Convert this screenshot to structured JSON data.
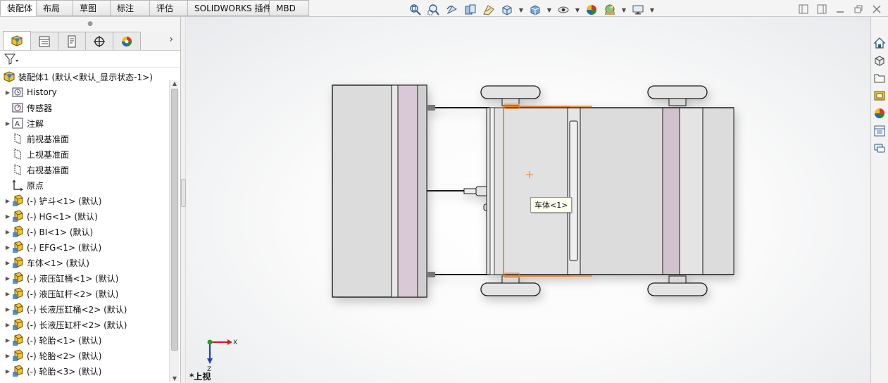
{
  "tabs": [
    {
      "label": "装配体",
      "active": true
    },
    {
      "label": "布局",
      "active": false
    },
    {
      "label": "草图",
      "active": false
    },
    {
      "label": "标注",
      "active": false
    },
    {
      "label": "评估",
      "active": false
    },
    {
      "label": "SOLIDWORKS 插件",
      "active": false
    },
    {
      "label": "MBD",
      "active": false
    }
  ],
  "headsup_icons": [
    "zoom-to-fit-icon",
    "zoom-to-area-icon",
    "previous-view-icon",
    "section-view-icon",
    "dynamic-annotation-icon",
    "view-orientation-icon",
    "display-style-icon",
    "hide-show-items-icon",
    "edit-appearance-icon",
    "apply-scene-icon",
    "view-settings-icon"
  ],
  "feature_tree": {
    "root": "装配体1 (默认<默认_显示状态-1>)",
    "items": [
      {
        "label": "History",
        "icon": "history-icon",
        "expandable": true
      },
      {
        "label": "传感器",
        "icon": "sensor-icon",
        "expandable": false
      },
      {
        "label": "注解",
        "icon": "annotation-icon",
        "expandable": true
      },
      {
        "label": "前视基准面",
        "icon": "plane-icon",
        "expandable": false
      },
      {
        "label": "上视基准面",
        "icon": "plane-icon",
        "expandable": false
      },
      {
        "label": "右视基准面",
        "icon": "plane-icon",
        "expandable": false
      },
      {
        "label": "原点",
        "icon": "origin-icon",
        "expandable": false
      },
      {
        "label": "(-) 铲斗<1> (默认)",
        "icon": "part-icon",
        "expandable": true
      },
      {
        "label": "(-) HG<1> (默认)",
        "icon": "part-icon",
        "expandable": true
      },
      {
        "label": "(-) BI<1> (默认)",
        "icon": "part-icon",
        "expandable": true
      },
      {
        "label": "(-) EFG<1> (默认)",
        "icon": "part-icon",
        "expandable": true
      },
      {
        "label": "车体<1> (默认)",
        "icon": "part-icon",
        "expandable": true
      },
      {
        "label": "(-) 液压缸桶<1> (默认)",
        "icon": "part-icon",
        "expandable": true
      },
      {
        "label": "(-) 液压缸杆<2> (默认)",
        "icon": "part-icon",
        "expandable": true
      },
      {
        "label": "(-) 长液压缸桶<2> (默认)",
        "icon": "part-icon",
        "expandable": true
      },
      {
        "label": "(-) 长液压缸杆<2> (默认)",
        "icon": "part-icon",
        "expandable": true
      },
      {
        "label": "(-) 轮胎<1> (默认)",
        "icon": "part-icon",
        "expandable": true
      },
      {
        "label": "(-) 轮胎<2> (默认)",
        "icon": "part-icon",
        "expandable": true
      },
      {
        "label": "(-) 轮胎<3> (默认)",
        "icon": "part-icon",
        "expandable": true
      }
    ]
  },
  "viewport": {
    "tooltip": "车体<1>",
    "view_label": "*上视",
    "triad": {
      "x": "X",
      "z": "Z"
    }
  },
  "colors": {
    "selection": "#e87f1c",
    "body_fill": "#dcdcdc",
    "bucket_panel": "#d9c9d6",
    "x_axis": "#d02020",
    "z_axis": "#2040c0",
    "origin_dot": "#20a020"
  }
}
